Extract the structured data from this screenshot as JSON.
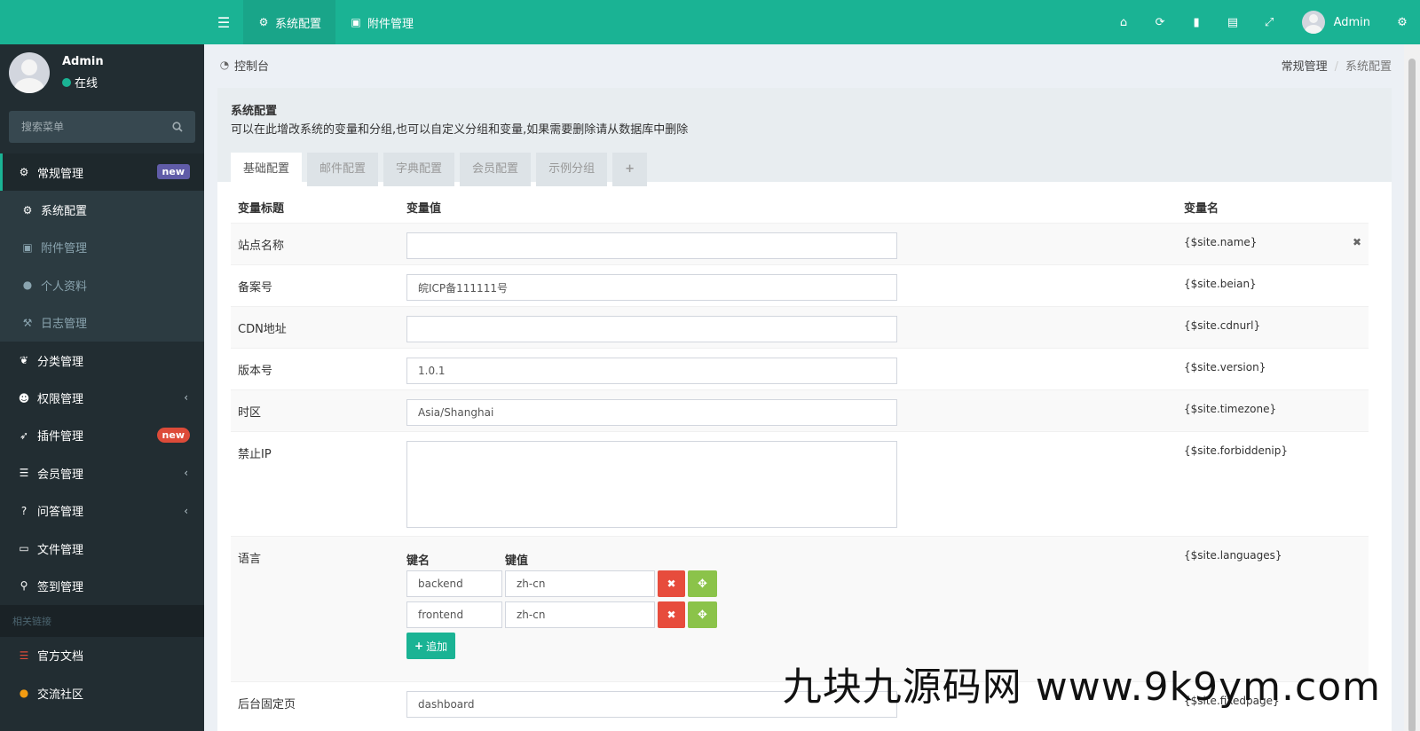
{
  "user": {
    "name": "Admin",
    "status": "在线"
  },
  "sidebar": {
    "search_placeholder": "搜索菜单",
    "items": [
      {
        "label": "常规管理",
        "badge": "new"
      },
      {
        "label": "系统配置"
      },
      {
        "label": "附件管理"
      },
      {
        "label": "个人资料"
      },
      {
        "label": "日志管理"
      },
      {
        "label": "分类管理"
      },
      {
        "label": "权限管理"
      },
      {
        "label": "插件管理",
        "badge": "new"
      },
      {
        "label": "会员管理"
      },
      {
        "label": "问答管理"
      },
      {
        "label": "文件管理"
      },
      {
        "label": "签到管理"
      }
    ],
    "section_header": "相关链接",
    "links": [
      {
        "label": "官方文档"
      },
      {
        "label": "交流社区"
      }
    ]
  },
  "navbar": {
    "tabs": [
      {
        "label": "系统配置"
      },
      {
        "label": "附件管理"
      }
    ],
    "username": "Admin"
  },
  "breadcrumb": {
    "left": "控制台",
    "items": [
      "常规管理",
      "系统配置"
    ]
  },
  "panel": {
    "title": "系统配置",
    "description": "可以在此增改系统的变量和分组,也可以自定义分组和变量,如果需要删除请从数据库中删除",
    "tabs": [
      "基础配置",
      "邮件配置",
      "字典配置",
      "会员配置",
      "示例分组"
    ],
    "plus": "+"
  },
  "table": {
    "headers": [
      "变量标题",
      "变量值",
      "变量名"
    ],
    "rows": [
      {
        "title": "站点名称",
        "value": "",
        "name": "{$site.name}"
      },
      {
        "title": "备案号",
        "value": "皖ICP备111111号",
        "name": "{$site.beian}"
      },
      {
        "title": "CDN地址",
        "value": "",
        "name": "{$site.cdnurl}"
      },
      {
        "title": "版本号",
        "value": "1.0.1",
        "name": "{$site.version}"
      },
      {
        "title": "时区",
        "value": "Asia/Shanghai",
        "name": "{$site.timezone}"
      },
      {
        "title": "禁止IP",
        "value": "",
        "name": "{$site.forbiddenip}"
      },
      {
        "title": "语言",
        "name": "{$site.languages}",
        "kv_key_header": "键名",
        "kv_value_header": "键值",
        "pairs": [
          {
            "key": "backend",
            "value": "zh-cn"
          },
          {
            "key": "frontend",
            "value": "zh-cn"
          }
        ],
        "add_label": "追加"
      },
      {
        "title": "后台固定页",
        "value": "dashboard",
        "name": "{$site.fixedpage}"
      }
    ]
  },
  "watermark": "九块九源码网 www.9k9ym.com",
  "colors": {
    "accent": "#1ab394",
    "sidebar": "#222d32",
    "danger": "#e74c3c",
    "success": "#8bc34a"
  }
}
